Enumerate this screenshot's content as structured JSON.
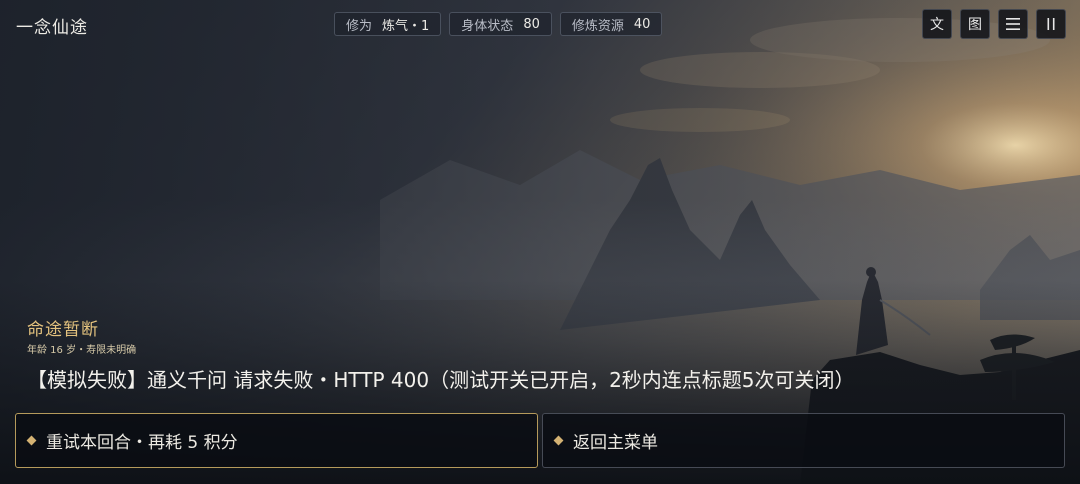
{
  "game_title": "一念仙途",
  "stats": [
    {
      "label": "修为",
      "value": "炼气・1"
    },
    {
      "label": "身体状态",
      "value": "80"
    },
    {
      "label": "修炼资源",
      "value": "40"
    }
  ],
  "toolbar": {
    "text_button": "文",
    "image_button": "图",
    "menu_icon": "≡",
    "pause_icon": "II"
  },
  "fate": {
    "heading": "命途暂断",
    "subtitle": "年龄 16 岁・寿限未明确",
    "message": "【模拟失败】通义千问 请求失败・HTTP 400（测试开关已开启，2秒内连点标题5次可关闭）"
  },
  "choices": {
    "retry": "重试本回合・再耗 5 积分",
    "back_to_menu": "返回主菜单"
  },
  "colors": {
    "accent_gold": "#e3c27e",
    "diamond": "#d4b273",
    "primary_border": "#b59a5b"
  }
}
